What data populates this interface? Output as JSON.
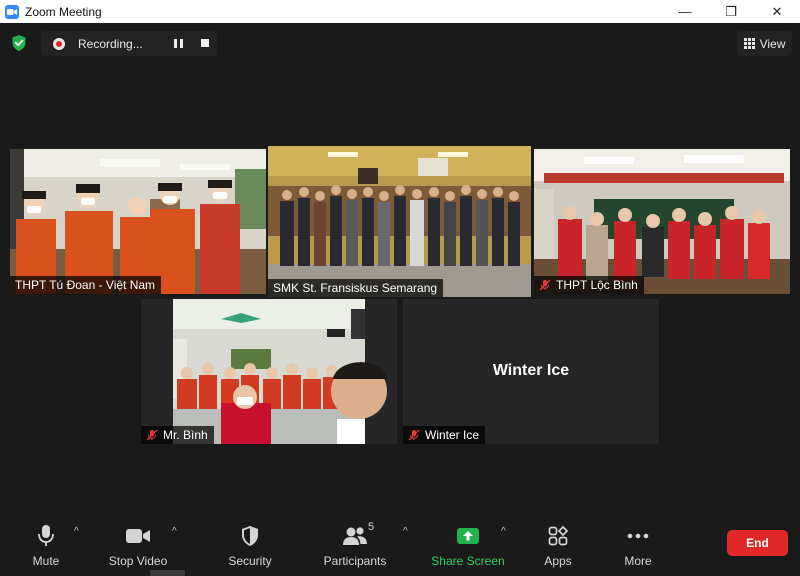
{
  "window": {
    "title": "Zoom Meeting",
    "controls": {
      "minimize": "—",
      "maximize": "❐",
      "close": "✕"
    }
  },
  "topbar": {
    "recording_label": "Recording...",
    "view_label": "View"
  },
  "participants": [
    {
      "name": "THPT Tú Đoan - Việt Nam",
      "muted": false,
      "active_speaker": false,
      "video": true
    },
    {
      "name": "SMK St. Fransiskus Semarang",
      "muted": false,
      "active_speaker": true,
      "video": true
    },
    {
      "name": "THPT Lộc Bình",
      "muted": true,
      "active_speaker": false,
      "video": true
    },
    {
      "name": "Mr. Bình",
      "muted": true,
      "active_speaker": false,
      "video": true
    },
    {
      "name": "Winter Ice",
      "muted": true,
      "active_speaker": false,
      "video": false,
      "display_name": "Winter Ice"
    }
  ],
  "toolbar": {
    "mute": "Mute",
    "stop_video": "Stop Video",
    "security": "Security",
    "participants": "Participants",
    "participants_count": "5",
    "share_screen": "Share Screen",
    "apps": "Apps",
    "more": "More",
    "end": "End"
  },
  "colors": {
    "background": "#1a1a1a",
    "active_speaker_border": "#c8e37a",
    "end_button": "#e02828",
    "share_screen": "#2fd160",
    "zoom_blue": "#2d8cff"
  }
}
